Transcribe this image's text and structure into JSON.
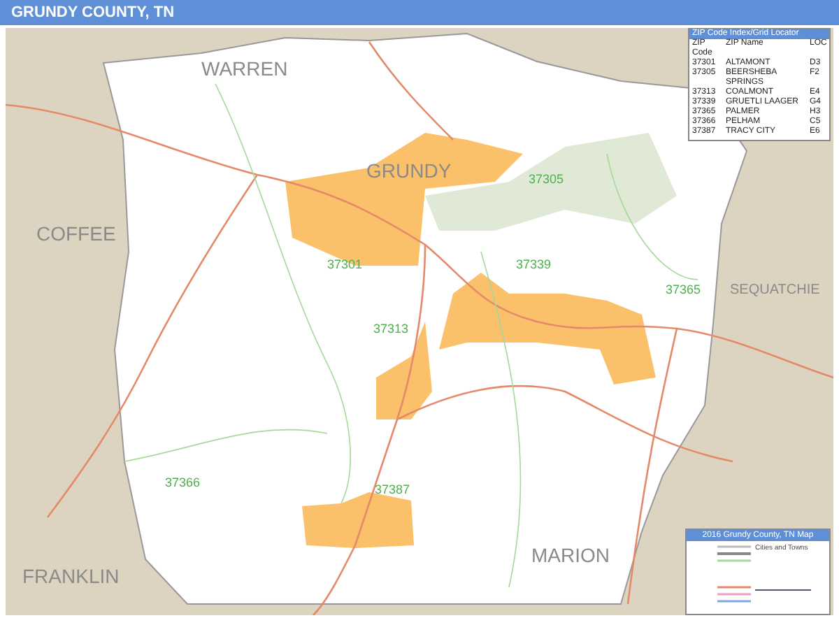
{
  "title": "GRUNDY COUNTY, TN",
  "county_labels": [
    "WARREN",
    "COFFEE",
    "GRUNDY",
    "SEQUATCHIE",
    "FRANKLIN",
    "MARION"
  ],
  "zip_labels": [
    "37305",
    "37301",
    "37339",
    "37365",
    "37313",
    "37366",
    "37387"
  ],
  "zip_index": {
    "title": "ZIP Code Index/Grid Locator",
    "columns": [
      "ZIP Code",
      "ZIP Name",
      "LOC"
    ],
    "rows": [
      [
        "37301",
        "ALTAMONT",
        "D3"
      ],
      [
        "37305",
        "BEERSHEBA SPRINGS",
        "F2"
      ],
      [
        "37313",
        "COALMONT",
        "E4"
      ],
      [
        "37339",
        "GRUETLI LAAGER",
        "G4"
      ],
      [
        "37365",
        "PALMER",
        "H3"
      ],
      [
        "37366",
        "PELHAM",
        "C5"
      ],
      [
        "37387",
        "TRACY CITY",
        "E6"
      ]
    ]
  },
  "legend": {
    "title": "2016 Grundy County, TN Map",
    "subtitle": "Cities and Towns"
  }
}
